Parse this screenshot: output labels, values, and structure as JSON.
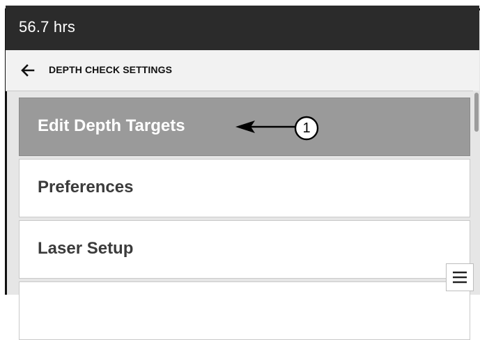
{
  "status_bar": {
    "hours_text": "56.7 hrs"
  },
  "header": {
    "back_icon": "arrow-left-icon",
    "title": "DEPTH CHECK SETTINGS"
  },
  "menu": {
    "items": [
      {
        "label": "Edit Depth Targets",
        "selected": true
      },
      {
        "label": "Preferences",
        "selected": false
      },
      {
        "label": "Laser Setup",
        "selected": false
      },
      {
        "label": "",
        "selected": false
      }
    ]
  },
  "callout": {
    "number": "1"
  },
  "controls": {
    "menu_icon": "hamburger-menu-icon"
  },
  "colors": {
    "status_bar_bg": "#2b2b2b",
    "selected_item_bg": "#9a9a9a",
    "item_bg": "#ffffff",
    "page_bg": "#e6e6e6"
  }
}
